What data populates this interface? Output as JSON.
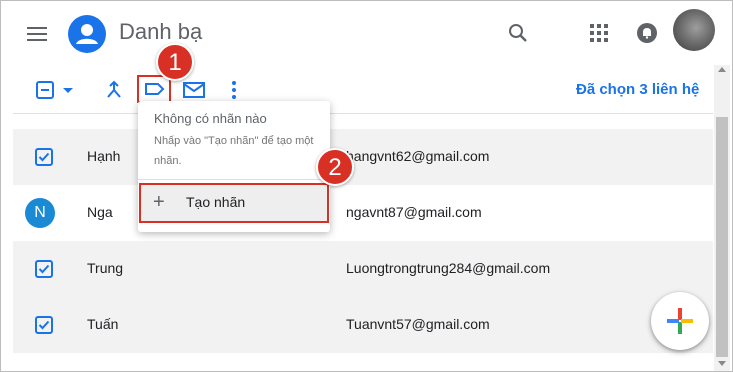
{
  "header": {
    "app_title": "Danh bạ"
  },
  "toolbar": {
    "selected_count": "Đã chọn 3 liên hệ"
  },
  "label_menu": {
    "empty_title": "Không có nhãn nào",
    "empty_hint": "Nhấp vào \"Tạo nhãn\" để tạo một nhãn.",
    "create_icon": "+",
    "create_label": "Tạo nhãn"
  },
  "annotations": {
    "step1": "1",
    "step2": "2"
  },
  "contacts": [
    {
      "name": "Hạnh",
      "email": "hangvnt62@gmail.com",
      "selected": true
    },
    {
      "name": "Nga",
      "email": "ngavnt87@gmail.com",
      "selected": false,
      "initial": "N"
    },
    {
      "name": "Trung",
      "email": "Luongtrongtrung284@gmail.com",
      "selected": true
    },
    {
      "name": "Tuấn",
      "email": "Tuanvnt57@gmail.com",
      "selected": true
    }
  ],
  "icons": {
    "menu": "menu-icon",
    "logo": "contacts-logo-icon",
    "search": "search-icon",
    "apps": "apps-grid-icon",
    "notifications": "notification-bell-icon",
    "checkbox_dropdown": "checkbox-dropdown-icon",
    "merge": "merge-icon",
    "label": "label-icon",
    "email": "email-icon",
    "more": "more-vert-icon",
    "create": "plus-icon",
    "fab": "add-contact-icon"
  },
  "colors": {
    "accent": "#1a73e8",
    "highlight": "#d93025",
    "selected_row": "#f2f2f2"
  }
}
